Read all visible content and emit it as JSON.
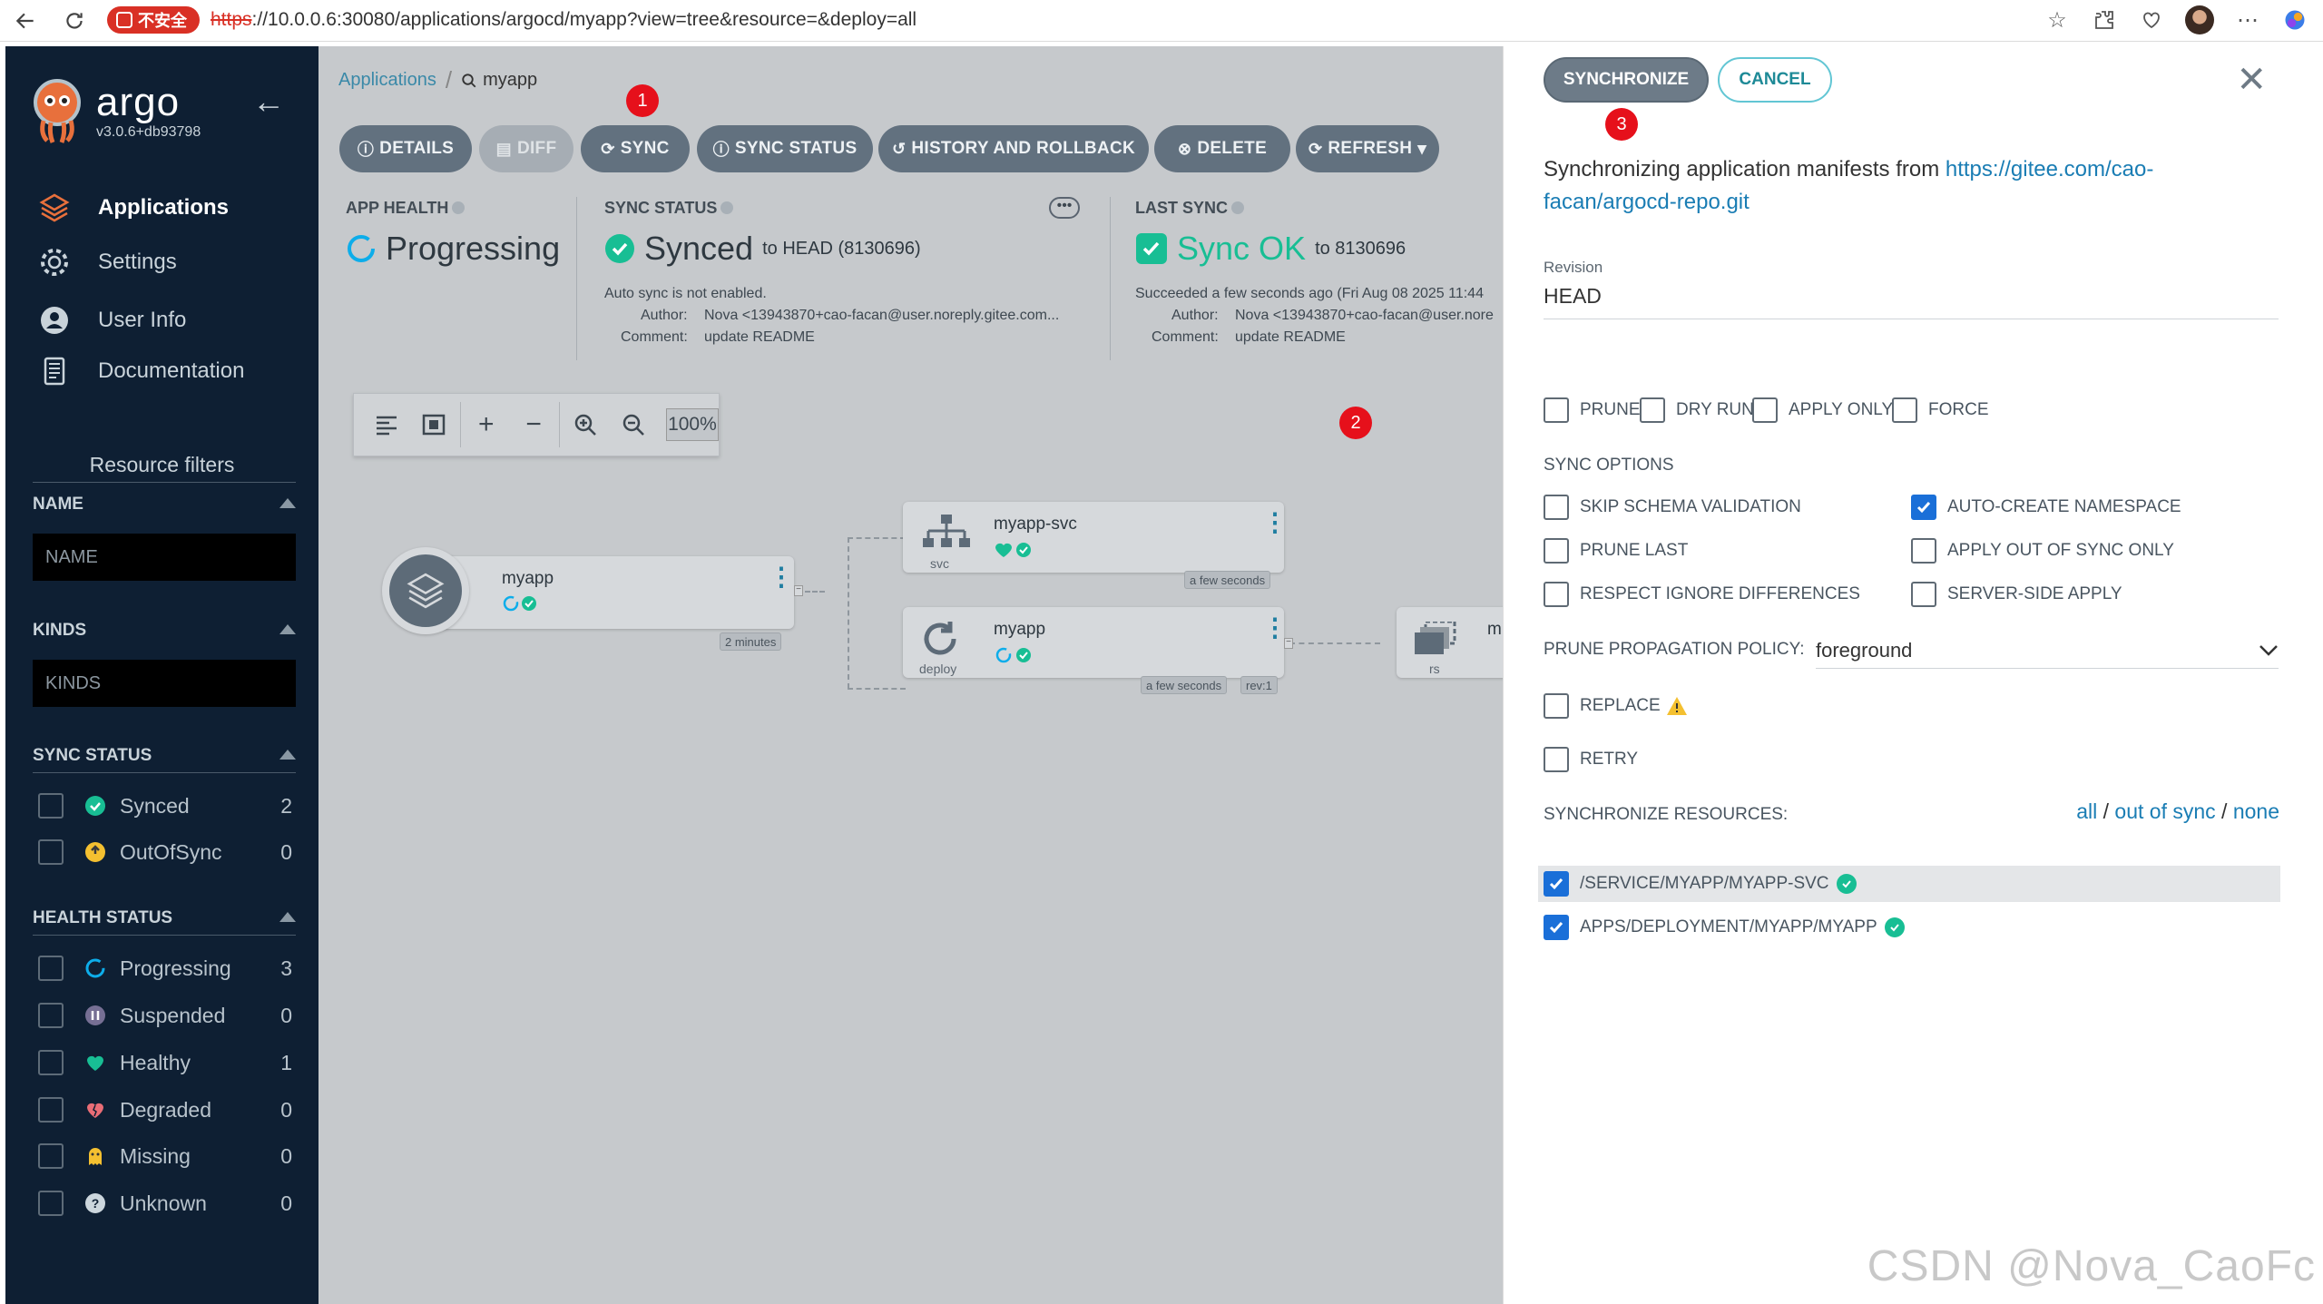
{
  "browser": {
    "security_label": "不安全",
    "url_scheme": "https",
    "url_rest": "://10.0.0.6:30080/applications/argocd/myapp?view=tree&resource=&deploy=all"
  },
  "sidebar": {
    "logo_word": "argo",
    "version": "v3.0.6+db93798",
    "nav": [
      {
        "label": "Applications",
        "icon": "layers-icon"
      },
      {
        "label": "Settings",
        "icon": "gear-icon"
      },
      {
        "label": "User Info",
        "icon": "user-icon"
      },
      {
        "label": "Documentation",
        "icon": "book-icon"
      }
    ],
    "resource_filters_title": "Resource filters",
    "name_head": "NAME",
    "name_placeholder": "NAME",
    "kinds_head": "KINDS",
    "kinds_placeholder": "KINDS",
    "sync_head": "SYNC STATUS",
    "sync_items": [
      {
        "label": "Synced",
        "count": "2"
      },
      {
        "label": "OutOfSync",
        "count": "0"
      }
    ],
    "health_head": "HEALTH STATUS",
    "health_items": [
      {
        "label": "Progressing",
        "count": "3"
      },
      {
        "label": "Suspended",
        "count": "0"
      },
      {
        "label": "Healthy",
        "count": "1"
      },
      {
        "label": "Degraded",
        "count": "0"
      },
      {
        "label": "Missing",
        "count": "0"
      },
      {
        "label": "Unknown",
        "count": "0"
      }
    ]
  },
  "main": {
    "breadcrumb": {
      "apps": "Applications",
      "current": "myapp"
    },
    "toolbar": {
      "details": "DETAILS",
      "diff": "DIFF",
      "sync": "SYNC",
      "sync_status": "SYNC STATUS",
      "history": "HISTORY AND ROLLBACK",
      "delete": "DELETE",
      "refresh": "REFRESH"
    },
    "markers": {
      "one": "1",
      "two": "2",
      "three": "3"
    },
    "app_health": {
      "label": "APP HEALTH",
      "value": "Progressing"
    },
    "sync_status": {
      "label": "SYNC STATUS",
      "value": "Synced",
      "to_head": "to HEAD (8130696)",
      "auto_sync": "Auto sync is not enabled.",
      "author_label": "Author:",
      "author": "Nova <13943870+cao-facan@user.noreply.gitee.com...",
      "comment_label": "Comment:",
      "comment": "update README"
    },
    "last_sync": {
      "label": "LAST SYNC",
      "value": "Sync OK",
      "to": "to 8130696",
      "succeeded": "Succeeded a few seconds ago (Fri Aug 08 2025 11:44",
      "author_label": "Author:",
      "author": "Nova <13943870+cao-facan@user.nore",
      "comment_label": "Comment:",
      "comment": "update README"
    },
    "zoom": "100%",
    "nodes": {
      "app": {
        "name": "myapp",
        "age": "2 minutes"
      },
      "svc": {
        "name": "myapp-svc",
        "kind": "svc",
        "age": "a few seconds"
      },
      "deploy": {
        "name": "myapp",
        "kind": "deploy",
        "age": "a few seconds",
        "rev": "rev:1"
      },
      "rs": {
        "name": "m",
        "kind": "rs"
      }
    }
  },
  "panel": {
    "synchronize": "SYNCHRONIZE",
    "cancel": "CANCEL",
    "msg_prefix": "Synchronizing application manifests from ",
    "repo_url": "https://gitee.com/cao-facan/argocd-repo.git",
    "revision_label": "Revision",
    "revision_value": "HEAD",
    "opts": {
      "prune": "PRUNE",
      "dry_run": "DRY RUN",
      "apply_only": "APPLY ONLY",
      "force": "FORCE"
    },
    "sync_options_head": "SYNC OPTIONS",
    "sync_options": {
      "skip_schema": "SKIP SCHEMA VALIDATION",
      "auto_ns": "AUTO-CREATE NAMESPACE",
      "prune_last": "PRUNE LAST",
      "apply_oos": "APPLY OUT OF SYNC ONLY",
      "respect_ignore": "RESPECT IGNORE DIFFERENCES",
      "server_side": "SERVER-SIDE APPLY"
    },
    "ppp_label": "PRUNE PROPAGATION POLICY:",
    "ppp_value": "foreground",
    "replace": "REPLACE",
    "retry": "RETRY",
    "sync_resources_head": "SYNCHRONIZE RESOURCES:",
    "links": {
      "all": "all",
      "out_of_sync": "out of sync",
      "none": "none",
      "sep": "/"
    },
    "resources": [
      "/SERVICE/MYAPP/MYAPP-SVC",
      "APPS/DEPLOYMENT/MYAPP/MYAPP"
    ]
  },
  "watermark": "CSDN @Nova_CaoFc",
  "colors": {
    "sidebar_bg": "#0e1f33",
    "synced": "#18be94",
    "progressing": "#0dadea",
    "accent_link": "#1a7db4",
    "marker": "#e6101b"
  }
}
